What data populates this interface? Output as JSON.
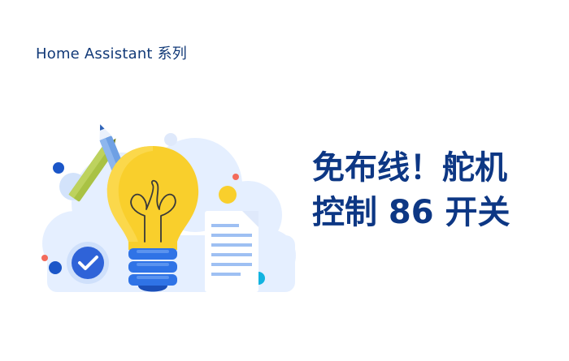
{
  "header": {
    "series_label": "Home Assistant 系列"
  },
  "headline": {
    "line1": "免布线！舵机",
    "line2": "控制 86 开关"
  },
  "colors": {
    "text_dark_blue": "#0d3784",
    "bulb_yellow": "#f9cf2c",
    "bulb_base_blue": "#2f73e6",
    "cloud_light_blue": "#e5efff",
    "pencil_green": "#a9c244",
    "pencil_blue": "#6fa0e4",
    "accent_red": "#f36b5b",
    "accent_cyan": "#12b3e0"
  },
  "icons": {
    "bulb": "lightbulb-icon",
    "check": "check-badge-icon",
    "document": "document-icon",
    "pencils": "pencil-icon"
  }
}
